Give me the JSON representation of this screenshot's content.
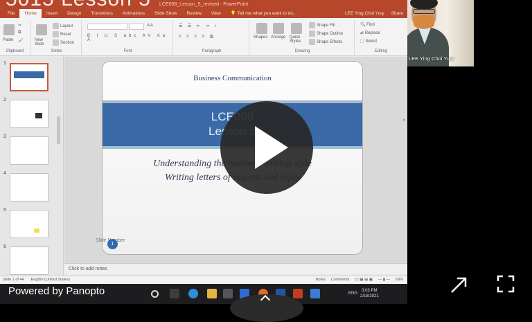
{
  "video_title": "5015 Lesson 5",
  "ppt": {
    "window_title": "LCE008_Lesson_5_revised - PowerPoint",
    "tabs": [
      "File",
      "Home",
      "Insert",
      "Design",
      "Transitions",
      "Animations",
      "Slide Show",
      "Review",
      "View"
    ],
    "active_tab": "Home",
    "tell_me": "Tell me what you want to do...",
    "user": "LEE Ying Choi Yury",
    "share": "Share",
    "ribbon": {
      "paste": "Paste",
      "new_slide": "New Slide",
      "layout": "Layout",
      "reset": "Reset",
      "section": "Section",
      "shapes": "Shapes",
      "arrange": "Arrange",
      "quick_styles": "Quick Styles",
      "shape_fill": "Shape Fill",
      "shape_outline": "Shape Outline",
      "shape_effects": "Shape Effects",
      "find": "Find",
      "replace": "Replace",
      "select": "Select",
      "groups": [
        "Clipboard",
        "Slides",
        "Font",
        "Paragraph",
        "Drawing",
        "Editing"
      ]
    },
    "thumbnails": [
      "1",
      "2",
      "3",
      "4",
      "5",
      "6"
    ],
    "slide": {
      "header": "Business Communication",
      "title_line1": "LCE008",
      "title_line2": "Lesson 5",
      "subtitle_line1": "Understanding the business writing style",
      "subtitle_line2": "Writing letters of request and reply",
      "slide_number_label": "Slide Number",
      "badge": "1"
    },
    "notes_placeholder": "Click to add notes",
    "status": {
      "slide_of": "Slide 1 of 44",
      "language": "English (United States)",
      "notes": "Notes",
      "comments": "Comments",
      "zoom": "69%"
    }
  },
  "taskbar": {
    "lang": "ENG",
    "time": "3:03 PM",
    "date": "2/18/2021"
  },
  "camera": {
    "name": "LEE Ying Choi Yury"
  },
  "player": {
    "powered_by": "Powered by Panopto"
  },
  "colors": {
    "ppt_accent": "#b7472a",
    "slide_band": "#3a6aa7",
    "badge": "#2f6ab3"
  }
}
